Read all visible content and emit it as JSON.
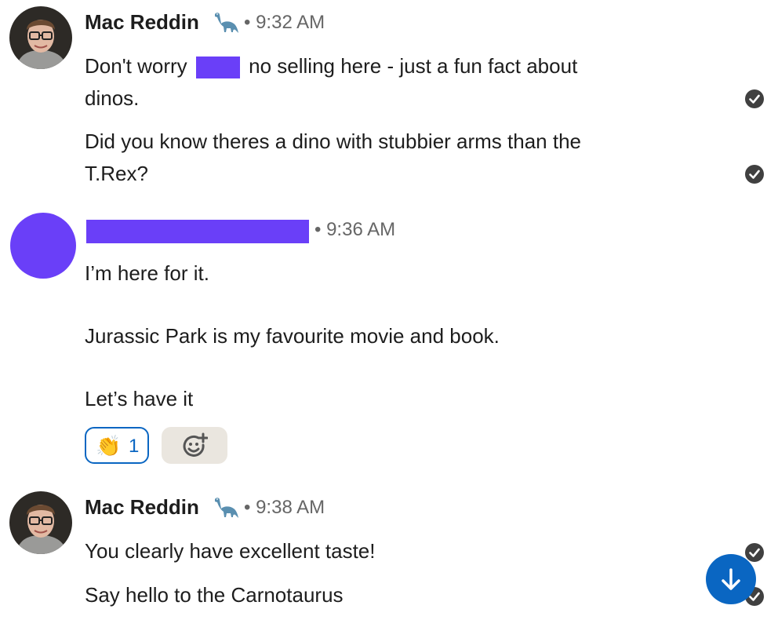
{
  "messages": [
    {
      "sender": "Mac Reddin",
      "sender_emoji": "sauropod-dino",
      "time": "9:32 AM",
      "lines": {
        "line1_before": "Don't worry",
        "line1_after": "no selling here - just a fun fact about",
        "line2": "dinos.",
        "line3": "Did you know theres a dino with stubbier arms than the",
        "line4": "T.Rex?"
      }
    },
    {
      "sender": "",
      "avatar_color": "#6a3ff8",
      "time": "9:36 AM",
      "lines": {
        "line1": "I’m here for it.",
        "line2": "Jurassic Park is my favourite movie and book.",
        "line3": "Let’s have it"
      },
      "reaction": {
        "emoji": "👏",
        "count": "1"
      }
    },
    {
      "sender": "Mac Reddin",
      "sender_emoji": "sauropod-dino",
      "time": "9:38 AM",
      "lines": {
        "line1": "You clearly have excellent taste!",
        "line2": "Say hello to the Carnotaurus"
      }
    }
  ],
  "colors": {
    "redaction": "#6a3ff8",
    "reaction_border": "#0a66c2",
    "fab": "#0a66c2",
    "read_check": "#404040"
  },
  "icons": {
    "read_receipt": "check-circle-icon",
    "add_reaction": "add-emoji-icon",
    "scroll_down": "arrow-down-icon"
  }
}
